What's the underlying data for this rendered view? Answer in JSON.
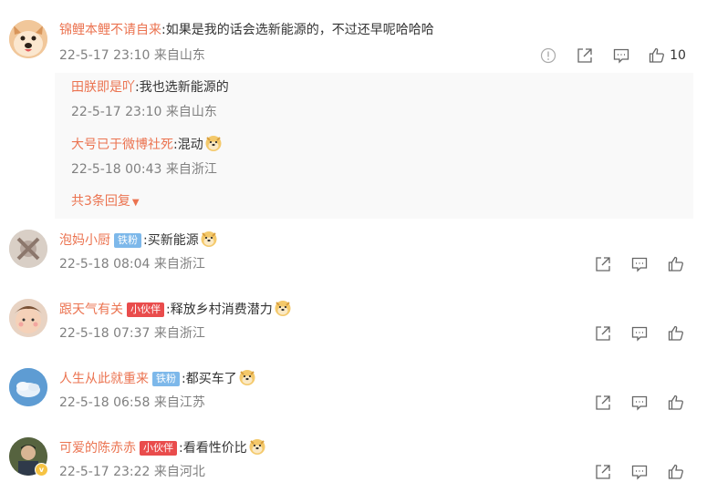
{
  "comments": [
    {
      "name": "锦鲤本鲤不请自来",
      "text": ":如果是我的话会选新能源的，不过还早呢哈哈哈",
      "meta": "22-5-17 23:10 来自山东",
      "likes": "10",
      "replies": [
        {
          "name": "田朕即是吖",
          "text": ":我也选新能源的",
          "meta": "22-5-17 23:10 来自山东"
        },
        {
          "name": "大号已于微博社死",
          "text": ":混动",
          "meta": "22-5-18 00:43 来自浙江",
          "emoji": true
        }
      ],
      "more_replies": "共3条回复"
    },
    {
      "name": "泡妈小厨",
      "badge": "铁粉",
      "badge_color": "#7db8ea",
      "text": ":买新能源",
      "meta": "22-5-18 08:04 来自浙江",
      "emoji": true
    },
    {
      "name": "跟天气有关",
      "badge": "小伙伴",
      "badge_color": "#e94c4c",
      "text": ":释放乡村消费潜力",
      "meta": "22-5-18 07:37 来自浙江",
      "emoji": true
    },
    {
      "name": "人生从此就重来",
      "badge": "铁粉",
      "badge_color": "#7db8ea",
      "text": ":都买车了",
      "meta": "22-5-18 06:58 来自江苏",
      "emoji": true
    },
    {
      "name": "可爱的陈赤赤",
      "badge": "小伙伴",
      "badge_color": "#e94c4c",
      "text": ":看看性价比",
      "meta": "22-5-17 23:22 来自河北",
      "emoji": true
    }
  ],
  "icons": {
    "report": "alert-circle-icon",
    "share": "share-icon",
    "comment": "comment-icon",
    "like": "thumbs-up-icon",
    "emoji": "doge-emoji-icon"
  },
  "colors": {
    "name": "#eb7350",
    "meta": "#808080",
    "reply_bg": "#f9f9f9"
  }
}
